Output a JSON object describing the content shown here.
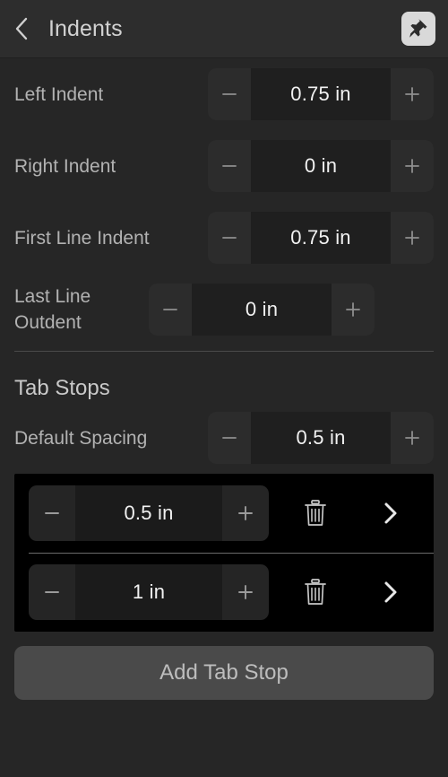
{
  "header": {
    "title": "Indents",
    "back_icon": "chevron-left-icon",
    "pin_icon": "pushpin-icon"
  },
  "indents": {
    "rows": [
      {
        "label": "Left Indent",
        "value": "0.75 in",
        "minus": "−",
        "plus": "+"
      },
      {
        "label": "Right Indent",
        "value": "0 in",
        "minus": "−",
        "plus": "+"
      },
      {
        "label": "First Line Indent",
        "value": "0.75 in",
        "minus": "−",
        "plus": "+"
      },
      {
        "label": "Last Line Outdent",
        "value": "0 in",
        "minus": "−",
        "plus": "+"
      }
    ]
  },
  "tab_stops": {
    "heading": "Tab Stops",
    "default_spacing": {
      "label": "Default Spacing",
      "value": "0.5 in",
      "minus": "−",
      "plus": "+"
    },
    "items": [
      {
        "value": "0.5 in",
        "minus": "−",
        "plus": "+",
        "delete_icon": "trash-icon",
        "disclosure_icon": "chevron-right-icon"
      },
      {
        "value": "1 in",
        "minus": "−",
        "plus": "+",
        "delete_icon": "trash-icon",
        "disclosure_icon": "chevron-right-icon"
      }
    ],
    "add_button_label": "Add Tab Stop"
  },
  "colors": {
    "background": "#262626",
    "header_background": "#2d2d2d",
    "panel_background": "#000000",
    "stepper_button": "#2c2c2c",
    "stepper_value": "#1f1f1f",
    "add_button": "#4a4a4a",
    "label_text": "#b2b2b2",
    "value_text": "#f2f2f2",
    "pin_button": "#d9d9d9"
  }
}
